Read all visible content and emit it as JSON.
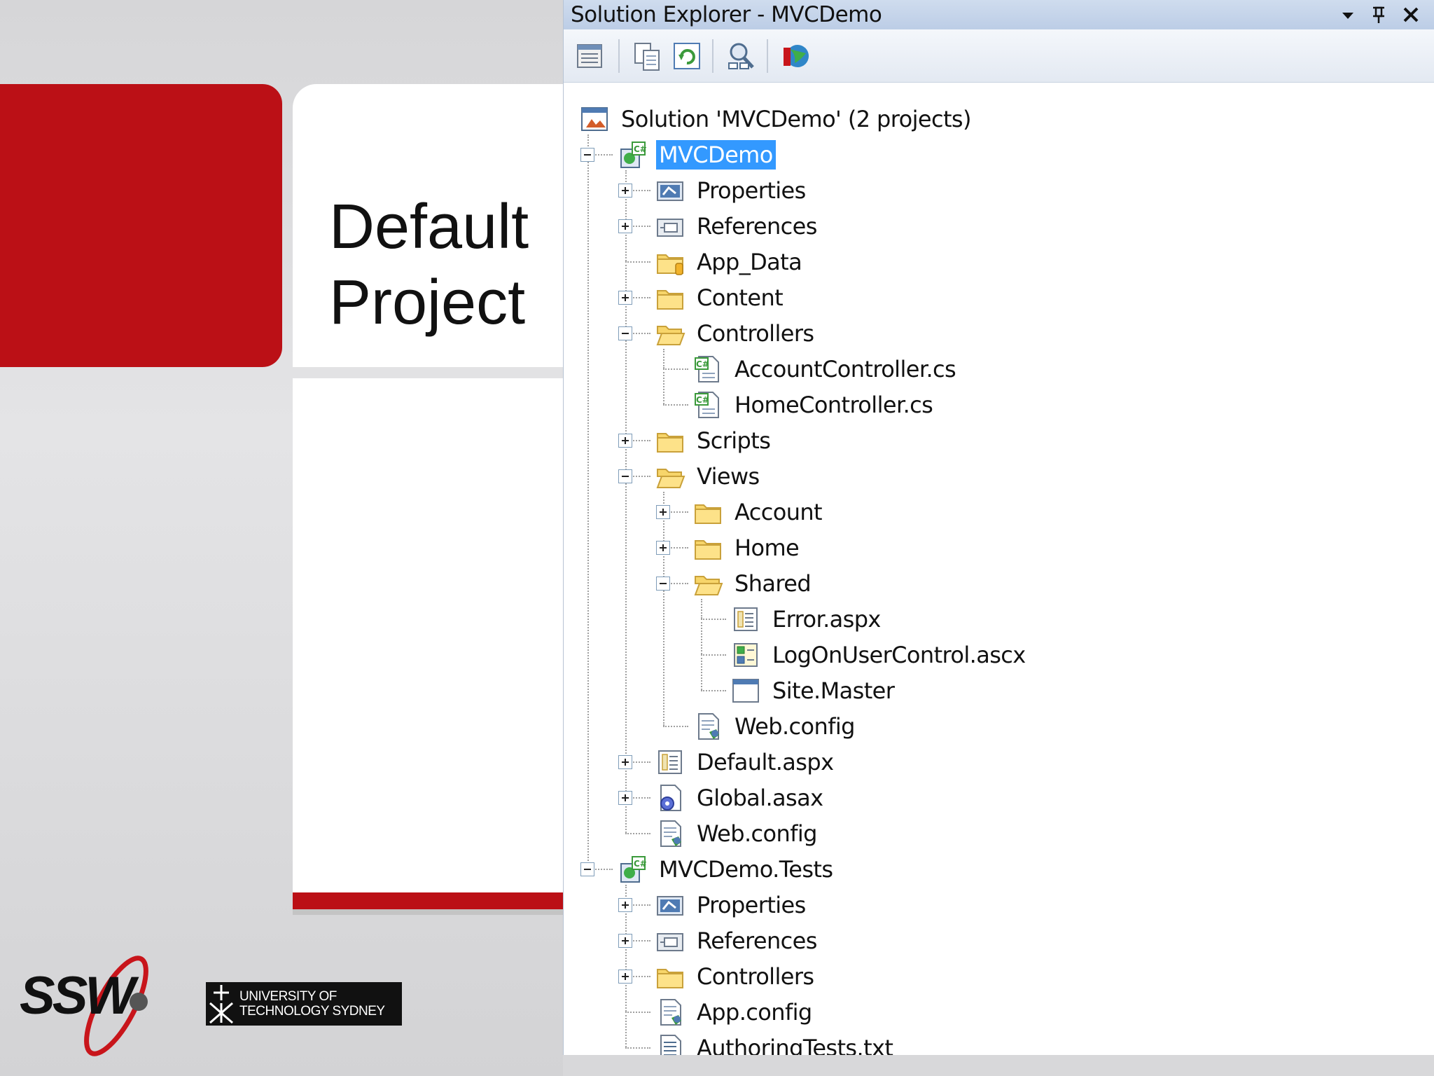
{
  "slide": {
    "title_line1": "Default",
    "title_line2": "Project",
    "colors": {
      "accent_red": "#bb1016",
      "card_white": "#ffffff"
    }
  },
  "logos": {
    "ssw": "SSW",
    "uts_line1": "UNIVERSITY OF",
    "uts_line2": "TECHNOLOGY SYDNEY"
  },
  "solution_explorer": {
    "title": "Solution Explorer - MVCDemo",
    "controls": [
      "dropdown-arrow-icon",
      "pin-icon",
      "close-icon"
    ],
    "toolbar": [
      "properties-icon",
      "show-all-files-icon",
      "refresh-icon",
      "view-class-diagram-icon",
      "web-config-icon"
    ],
    "tree": [
      {
        "label": "Solution 'MVCDemo' (2 projects)",
        "icon": "solution-icon",
        "level": 0,
        "expander": "none"
      },
      {
        "label": "MVCDemo",
        "icon": "csharp-web-project-icon",
        "level": 1,
        "expander": "minus",
        "selected": true
      },
      {
        "label": "Properties",
        "icon": "properties-folder-icon",
        "level": 2,
        "expander": "plus"
      },
      {
        "label": "References",
        "icon": "references-folder-icon",
        "level": 2,
        "expander": "plus"
      },
      {
        "label": "App_Data",
        "icon": "app-data-folder-icon",
        "level": 2,
        "expander": "none"
      },
      {
        "label": "Content",
        "icon": "folder-icon",
        "level": 2,
        "expander": "plus"
      },
      {
        "label": "Controllers",
        "icon": "open-folder-icon",
        "level": 2,
        "expander": "minus"
      },
      {
        "label": "AccountController.cs",
        "icon": "csharp-file-icon",
        "level": 3,
        "expander": "none"
      },
      {
        "label": "HomeController.cs",
        "icon": "csharp-file-icon",
        "level": 3,
        "expander": "none"
      },
      {
        "label": "Scripts",
        "icon": "folder-icon",
        "level": 2,
        "expander": "plus"
      },
      {
        "label": "Views",
        "icon": "open-folder-icon",
        "level": 2,
        "expander": "minus"
      },
      {
        "label": "Account",
        "icon": "folder-icon",
        "level": 3,
        "expander": "plus"
      },
      {
        "label": "Home",
        "icon": "folder-icon",
        "level": 3,
        "expander": "plus"
      },
      {
        "label": "Shared",
        "icon": "open-folder-icon",
        "level": 3,
        "expander": "minus"
      },
      {
        "label": "Error.aspx",
        "icon": "aspx-file-icon",
        "level": 4,
        "expander": "none"
      },
      {
        "label": "LogOnUserControl.ascx",
        "icon": "ascx-file-icon",
        "level": 4,
        "expander": "none"
      },
      {
        "label": "Site.Master",
        "icon": "master-page-icon",
        "level": 4,
        "expander": "none"
      },
      {
        "label": "Web.config",
        "icon": "config-file-icon",
        "level": 3,
        "expander": "none"
      },
      {
        "label": "Default.aspx",
        "icon": "aspx-file-icon",
        "level": 2,
        "expander": "plus"
      },
      {
        "label": "Global.asax",
        "icon": "global-asax-icon",
        "level": 2,
        "expander": "plus"
      },
      {
        "label": "Web.config",
        "icon": "config-file-icon",
        "level": 2,
        "expander": "none"
      },
      {
        "label": "MVCDemo.Tests",
        "icon": "csharp-project-icon",
        "level": 1,
        "expander": "minus"
      },
      {
        "label": "Properties",
        "icon": "properties-folder-icon",
        "level": 2,
        "expander": "plus"
      },
      {
        "label": "References",
        "icon": "references-folder-icon",
        "level": 2,
        "expander": "plus"
      },
      {
        "label": "Controllers",
        "icon": "folder-icon",
        "level": 2,
        "expander": "plus"
      },
      {
        "label": "App.config",
        "icon": "config-file-icon",
        "level": 2,
        "expander": "none"
      },
      {
        "label": "AuthoringTests.txt",
        "icon": "text-file-icon",
        "level": 2,
        "expander": "none"
      }
    ]
  }
}
